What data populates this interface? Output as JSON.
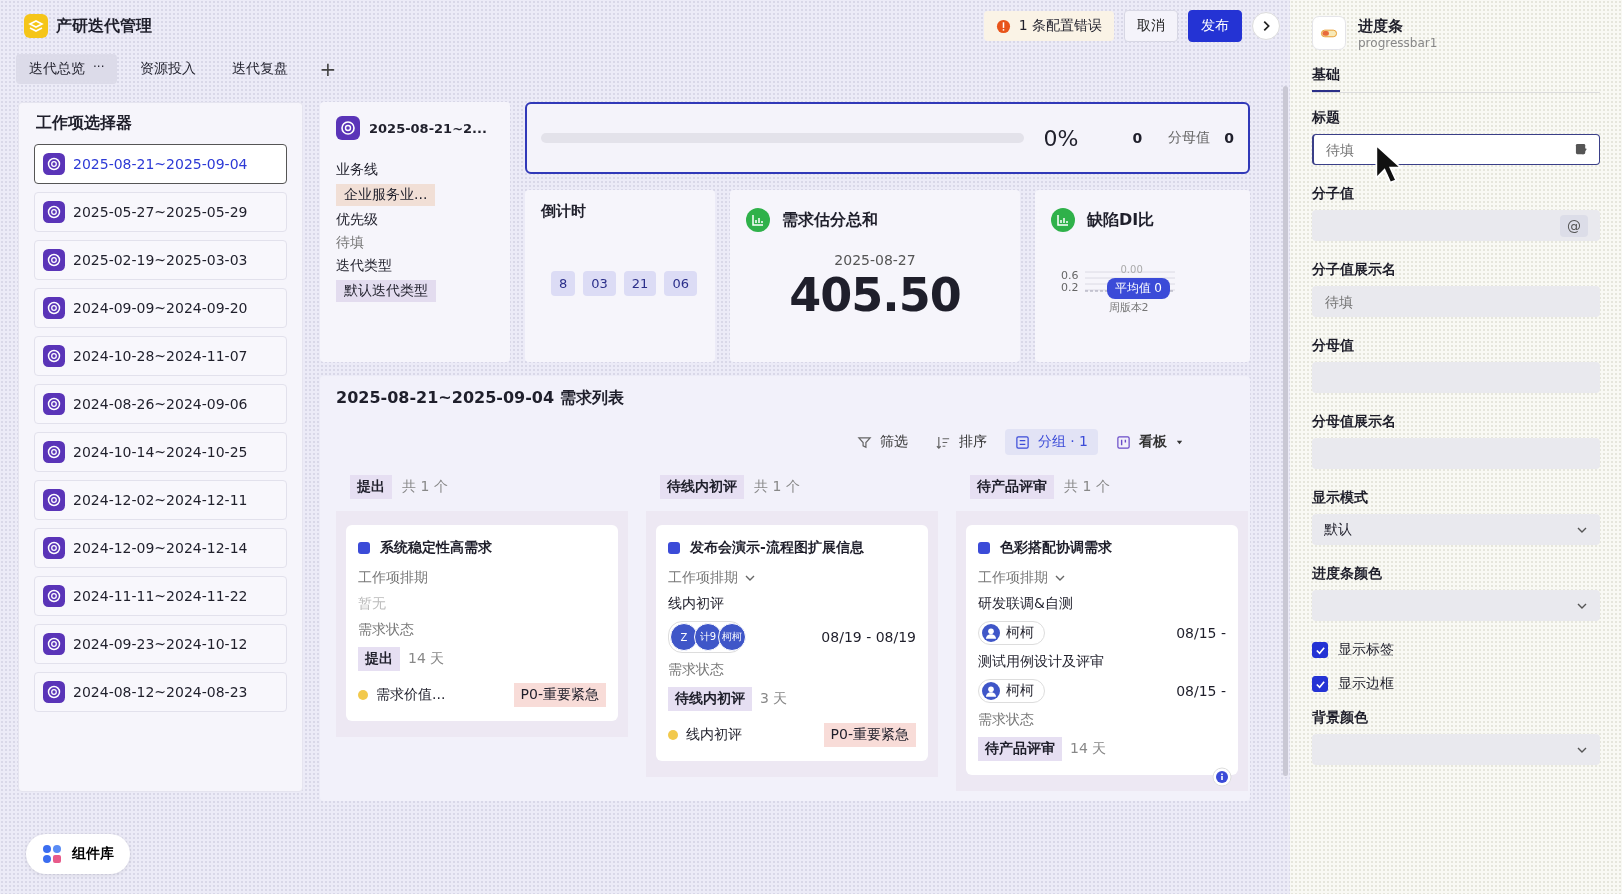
{
  "app": {
    "title": "产研迭代管理",
    "error_badge": "1 条配置错误",
    "cancel": "取消",
    "publish": "发布"
  },
  "tabs": [
    {
      "label": "迭代总览",
      "selected": true,
      "more": "···"
    },
    {
      "label": "资源投入",
      "selected": false
    },
    {
      "label": "迭代复盘",
      "selected": false
    }
  ],
  "add_tab": "+",
  "selector": {
    "title": "工作项选择器",
    "items": [
      {
        "label": "2025-08-21~2025-09-04",
        "selected": true
      },
      {
        "label": "2025-05-27~2025-05-29",
        "selected": false
      },
      {
        "label": "2025-02-19~2025-03-03",
        "selected": false
      },
      {
        "label": "2024-09-09~2024-09-20",
        "selected": false
      },
      {
        "label": "2024-10-28~2024-11-07",
        "selected": false
      },
      {
        "label": "2024-08-26~2024-09-06",
        "selected": false
      },
      {
        "label": "2024-10-14~2024-10-25",
        "selected": false
      },
      {
        "label": "2024-12-02~2024-12-11",
        "selected": false
      },
      {
        "label": "2024-12-09~2024-12-14",
        "selected": false
      },
      {
        "label": "2024-11-11~2024-11-22",
        "selected": false
      },
      {
        "label": "2024-09-23~2024-10-12",
        "selected": false
      },
      {
        "label": "2024-08-12~2024-08-23",
        "selected": false
      }
    ]
  },
  "info_card": {
    "title": "2025-08-21~2...",
    "fields": [
      {
        "label": "业务线",
        "value": "企业服务业...",
        "kind": "tag",
        "color": "#f1dfd6"
      },
      {
        "label": "优先级",
        "placeholder": "待填",
        "kind": "placeholder"
      },
      {
        "label": "迭代类型",
        "value": "默认迭代类型",
        "kind": "tag",
        "color": "#e3dcef"
      }
    ]
  },
  "progress_card": {
    "selected": true,
    "level": 0,
    "percent": "0%",
    "numerator": "0",
    "denominator_label": "分母值",
    "denominator": "0"
  },
  "countdown": {
    "title": "倒计时",
    "segments": [
      "8",
      "03",
      "21",
      "06"
    ]
  },
  "sum_card": {
    "title": "需求估分总和",
    "date": "2025-08-27",
    "value": "405.50"
  },
  "defect_card": {
    "title": "缺陷DI比",
    "yticks": [
      "0.6",
      "0.2"
    ],
    "value_label": "0.00",
    "tooltip": "平均值 0",
    "xlabel": "周版本2"
  },
  "list": {
    "title": "2025-08-21~2025-09-04 需求列表",
    "toolbar": [
      {
        "label": "筛选",
        "selected": false
      },
      {
        "label": "排序",
        "selected": false
      },
      {
        "label": "分组 · 1",
        "selected": true
      },
      {
        "label": "看板",
        "selected": false,
        "dropdown": true
      }
    ],
    "columns": [
      {
        "status": "提出",
        "count": "共 1 个",
        "cards": [
          {
            "title": "系统稳定性高需求",
            "schedule_label": "工作项排期",
            "expandable": false,
            "empty": "暂无",
            "status_label": "需求状态",
            "status": "提出",
            "days": "14 天",
            "footer": {
              "text": "需求价值...",
              "priority": "P0-重要紧急"
            }
          }
        ]
      },
      {
        "status": "待线内初评",
        "count": "共 1 个",
        "cards": [
          {
            "title": "发布会演示-流程图扩展信息",
            "schedule_label": "工作项排期",
            "expandable": true,
            "tasks": [
              {
                "name": "线内初评",
                "avatars": [
                  "Z",
                  "计9",
                  "柯柯"
                ],
                "dates": "08/19 - 08/19"
              }
            ],
            "status_label": "需求状态",
            "status": "待线内初评",
            "days": "3 天",
            "footer": {
              "text": "线内初评",
              "priority": "P0-重要紧急"
            }
          }
        ]
      },
      {
        "status": "待产品评审",
        "count": "共 1 个",
        "cards": [
          {
            "title": "色彩搭配协调需求",
            "schedule_label": "工作项排期",
            "expandable": true,
            "tasks": [
              {
                "name": "研发联调&自测",
                "people": [
                  "柯柯"
                ],
                "dates": "08/15 -"
              },
              {
                "name": "测试用例设计及评审",
                "people": [
                  "柯柯"
                ],
                "dates": "08/15 -"
              }
            ],
            "status_label": "需求状态",
            "status": "待产品评审",
            "days": "14 天"
          }
        ]
      }
    ]
  },
  "panel": {
    "name": "进度条",
    "id": "progressbar1",
    "tabs": [
      {
        "label": "基础",
        "selected": true
      }
    ],
    "fields": [
      {
        "label": "标题",
        "kind": "text",
        "placeholder": "待填",
        "focused": true
      },
      {
        "label": "分子值",
        "kind": "binding",
        "symbol": "@"
      },
      {
        "label": "分子值展示名",
        "kind": "text",
        "placeholder": "待填",
        "focused": false
      },
      {
        "label": "分母值",
        "kind": "text",
        "focused": false
      },
      {
        "label": "分母值展示名",
        "kind": "text",
        "focused": false
      },
      {
        "label": "显示模式",
        "kind": "select",
        "value": "默认"
      },
      {
        "label": "进度条颜色",
        "kind": "select"
      },
      {
        "label": "显示标签",
        "kind": "checkbox",
        "checked": true
      },
      {
        "label": "显示边框",
        "kind": "checkbox",
        "checked": true
      },
      {
        "label": "背景颜色",
        "kind": "select"
      }
    ]
  },
  "library_button": "组件库"
}
